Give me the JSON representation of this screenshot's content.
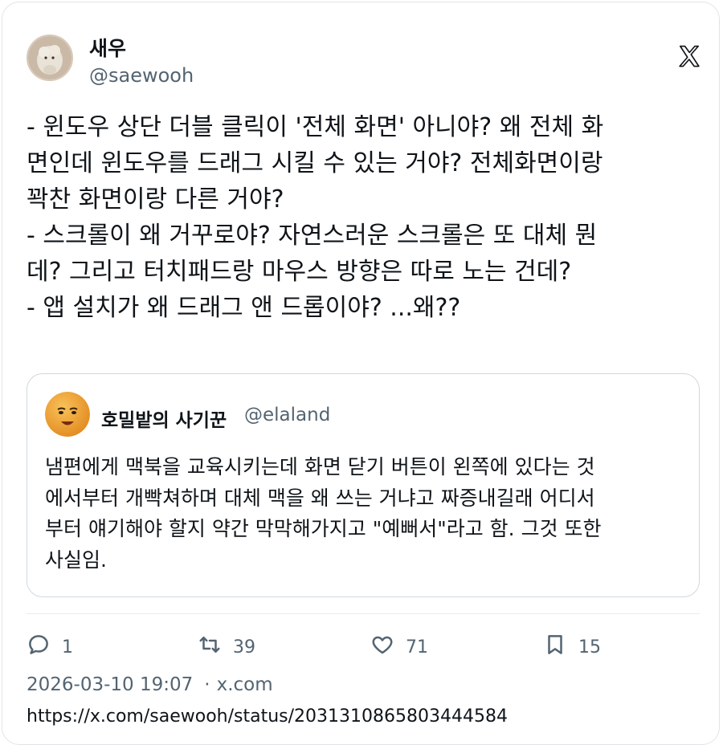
{
  "author": {
    "display_name": "새우",
    "handle": "@saewooh"
  },
  "brand": {
    "logo_icon": "x-logo-icon"
  },
  "tweet": {
    "lines": [
      "- 윈도우 상단 더블 클릭이 '전체 화면' 아니야? 왜 전체 화",
      "면인데 윈도우를 드래그 시킬 수 있는 거야? 전체화면이랑",
      "꽉찬 화면이랑 다른 거야?",
      "- 스크롤이 왜 거꾸로야? 자연스러운 스크롤은 또 대체 뭔",
      "데? 그리고 터치패드랑 마우스 방향은 따로 노는 건데?",
      "- 앱 설치가 왜 드래그 앤 드롭이야? ...왜??"
    ]
  },
  "quote": {
    "display_name": "호밀밭의 사기꾼",
    "handle": "@elaland",
    "lines": [
      "냄편에게 맥북을 교육시키는데 화면 닫기 버튼이 왼쪽에 있다는 것",
      "에서부터 개빡쳐하며 대체 맥을 왜 쓰는 거냐고 짜증내길래 어디서",
      "부터 얘기해야 할지 약간 막막해가지고 \"예뻐서\"라고 함. 그것 또한",
      "사실임."
    ]
  },
  "actions": {
    "replies": "1",
    "retweets": "39",
    "likes": "71",
    "bookmarks": "15"
  },
  "meta": {
    "timestamp": "2026-03-10 19:07",
    "separator": "·",
    "domain": "x.com",
    "url": "https://x.com/saewooh/status/2031310865803444584"
  },
  "colors": {
    "text": "#0f1419",
    "secondary": "#536471",
    "border": "#cfd9de"
  }
}
